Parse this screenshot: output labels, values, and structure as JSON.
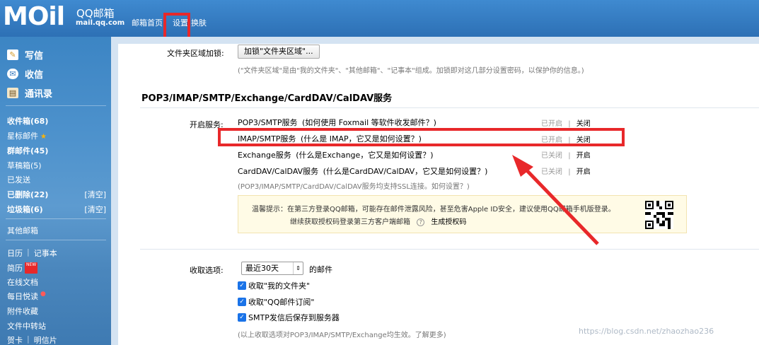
{
  "header": {
    "logo_text": "MOil",
    "brand_name": "QQ邮箱",
    "brand_domain": "mail.qq.com",
    "nav": [
      "邮箱首页",
      "设置",
      "换肤"
    ],
    "nav_sep": "|"
  },
  "sidebar": {
    "actions": [
      {
        "label": "写信",
        "icon": "pencil-icon"
      },
      {
        "label": "收信",
        "icon": "inbox-icon"
      },
      {
        "label": "通讯录",
        "icon": "contacts-icon"
      }
    ],
    "folders": [
      {
        "label": "收件箱(68)",
        "extra": ""
      },
      {
        "label": "星标邮件",
        "extra": ""
      },
      {
        "label": "群邮件(45)",
        "extra": ""
      },
      {
        "label": "草稿箱(5)",
        "extra": ""
      },
      {
        "label": "已发送",
        "extra": ""
      },
      {
        "label": "已删除(22)",
        "extra": "[清空]"
      },
      {
        "label": "垃圾箱(6)",
        "extra": "[清空]"
      }
    ],
    "other_mailbox": "其他邮箱",
    "tools": {
      "calendar": "日历",
      "notes": "记事本",
      "resume": "简历",
      "resume_badge": "NEW",
      "online_docs": "在线文档",
      "daily_read": "每日悦读",
      "attachments": "附件收藏",
      "file_transfer": "文件中转站",
      "card": "贺卡",
      "postcard": "明信片"
    }
  },
  "folder_area": {
    "label": "文件夹区域加锁:",
    "button": "加锁\"文件夹区域\"...",
    "desc": "(\"文件夹区域\"是由\"我的文件夹\"、\"其他邮箱\"、\"记事本\"组成。加锁即对这几部分设置密码，以保护你的信息。)"
  },
  "pop3_section": {
    "title": "POP3/IMAP/SMTP/Exchange/CardDAV/CalDAV服务",
    "enable_label": "开启服务:",
    "services": [
      {
        "name": "POP3/SMTP服务",
        "help": "(如何使用 Foxmail 等软件收发邮件？)",
        "status": "已开启",
        "sep": "|",
        "action": "关闭"
      },
      {
        "name": "IMAP/SMTP服务",
        "help": "(什么是 IMAP，它又是如何设置？)",
        "status": "已开启",
        "sep": "|",
        "action": "关闭"
      },
      {
        "name": "Exchange服务",
        "help": "(什么是Exchange，它又是如何设置？)",
        "status": "已关闭",
        "sep": "|",
        "action": "开启"
      },
      {
        "name": "CardDAV/CalDAV服务",
        "help": "(什么是CardDAV/CalDAV，它又是如何设置？)",
        "status": "已关闭",
        "sep": "|",
        "action": "开启"
      }
    ],
    "ssl_note": "(POP3/IMAP/SMTP/CardDAV/CalDAV服务均支持SSL连接。如何设置？)",
    "tip_line1": "温馨提示：在第三方登录QQ邮箱，可能存在邮件泄露风险，甚至危害Apple ID安全，建议使用QQ邮箱手机版登录。",
    "tip_line2": "继续获取授权码登录第三方客户端邮箱",
    "tip_link": "生成授权码"
  },
  "receive": {
    "label": "收取选项:",
    "select_value": "最近30天",
    "suffix": "的邮件",
    "options": [
      "收取\"我的文件夹\"",
      "收取\"QQ邮件订阅\"",
      "SMTP发信后保存到服务器"
    ],
    "note": "(以上收取选项对POP3/IMAP/SMTP/Exchange均生效。了解更多)"
  },
  "watermark": "https://blog.csdn.net/zhaozhao236",
  "colors": {
    "highlight": "#e8282a",
    "header_blue": "#3f8ad0",
    "checkbox": "#1a73e8"
  }
}
